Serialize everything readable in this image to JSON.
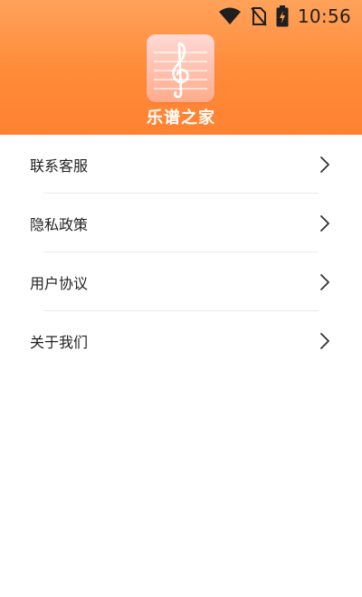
{
  "status_bar": {
    "time": "10:56",
    "icons": [
      "wifi-icon",
      "no-sim-icon",
      "battery-charging-icon"
    ]
  },
  "header": {
    "app_name": "乐谱之家",
    "logo_icon": "treble-clef-staff-icon",
    "colors": {
      "gradient_top": "#ffa25a",
      "gradient_bottom": "#ff8232",
      "logo_bg": "#ffc4b4"
    }
  },
  "menu": {
    "items": [
      {
        "label": "联系客服",
        "icon": "chevron-right-icon"
      },
      {
        "label": "隐私政策",
        "icon": "chevron-right-icon"
      },
      {
        "label": "用户协议",
        "icon": "chevron-right-icon"
      },
      {
        "label": "关于我们",
        "icon": "chevron-right-icon"
      }
    ]
  }
}
